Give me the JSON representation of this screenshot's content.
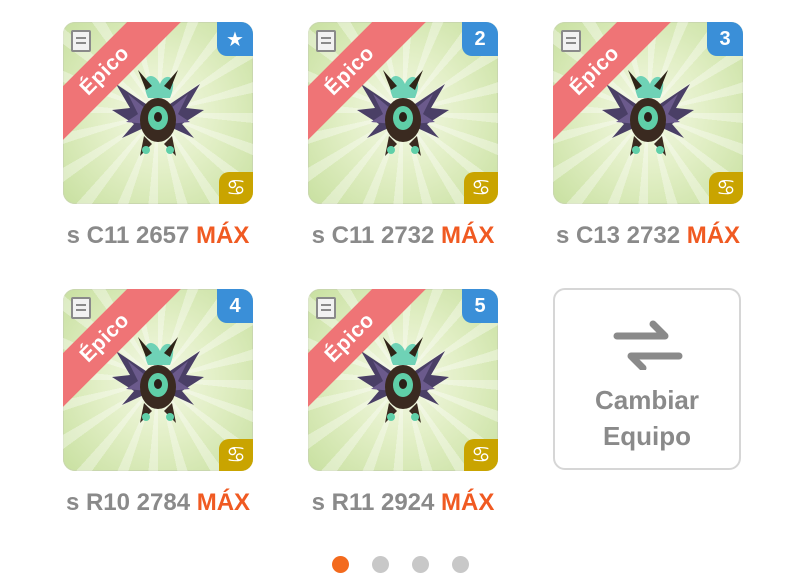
{
  "cards": [
    {
      "rarity": "Épico",
      "badge": "★",
      "sign": "♋",
      "name": "s C11",
      "power": "2657",
      "max": "MÁX"
    },
    {
      "rarity": "Épico",
      "badge": "2",
      "sign": "♋",
      "name": "s C11",
      "power": "2732",
      "max": "MÁX"
    },
    {
      "rarity": "Épico",
      "badge": "3",
      "sign": "♋",
      "name": "s C13",
      "power": "2732",
      "max": "MÁX"
    },
    {
      "rarity": "Épico",
      "badge": "4",
      "sign": "♋",
      "name": "s R10",
      "power": "2784",
      "max": "MÁX"
    },
    {
      "rarity": "Épico",
      "badge": "5",
      "sign": "♋",
      "name": "s R11",
      "power": "2924",
      "max": "MÁX"
    }
  ],
  "switch_team": {
    "line1": "Cambiar",
    "line2": "Equipo",
    "icon": "swap-arrows-icon"
  },
  "pager": {
    "count": 4,
    "active": 1
  },
  "colors": {
    "ribbon": "#ef7476",
    "badge": "#3a8fd8",
    "sign": "#c9a400",
    "max": "#f05a22",
    "dot_active": "#f36a1d",
    "dot": "#c8c8c8"
  }
}
